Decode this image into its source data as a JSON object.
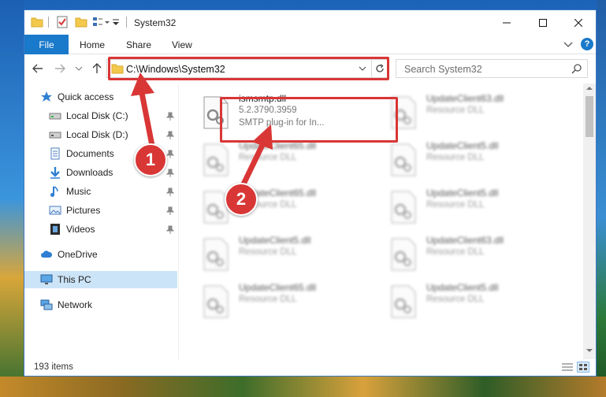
{
  "window": {
    "title": "System32",
    "ribbon_tabs": [
      "File",
      "Home",
      "Share",
      "View"
    ]
  },
  "navbar": {
    "address": "C:\\Windows\\System32",
    "search_placeholder": "Search System32"
  },
  "sidebar": {
    "items": [
      {
        "label": "Quick access",
        "icon": "star-icon",
        "pinned": false
      },
      {
        "label": "Local Disk (C:)",
        "icon": "drive-icon",
        "pinned": true
      },
      {
        "label": "Local Disk (D:)",
        "icon": "drive-icon",
        "pinned": true
      },
      {
        "label": "Documents",
        "icon": "documents-icon",
        "pinned": true
      },
      {
        "label": "Downloads",
        "icon": "download-arrow-icon",
        "pinned": true
      },
      {
        "label": "Music",
        "icon": "music-note-icon",
        "pinned": true
      },
      {
        "label": "Pictures",
        "icon": "pictures-icon",
        "pinned": true
      },
      {
        "label": "Videos",
        "icon": "film-icon",
        "pinned": true
      },
      {
        "label": "OneDrive",
        "icon": "cloud-icon",
        "pinned": false
      },
      {
        "label": "This PC",
        "icon": "monitor-icon",
        "pinned": false,
        "selected": true
      },
      {
        "label": "Network",
        "icon": "network-icon",
        "pinned": false
      }
    ]
  },
  "files": {
    "selected": {
      "name": "ismsmtp.dll",
      "version": "5.2.3790.3959",
      "description": "SMTP plug-in for In..."
    },
    "blurred": [
      {
        "name": "UpdateClient63.dll",
        "type": "Resource DLL"
      },
      {
        "name": "UpdateClient65.dll",
        "type": "Resource DLL"
      },
      {
        "name": "UpdateClient5.dll",
        "type": "Resource DLL"
      },
      {
        "name": "UpdateClient65.dll",
        "type": "Resource DLL"
      },
      {
        "name": "UpdateClient5.dll",
        "type": "Resource DLL"
      },
      {
        "name": "UpdateClient5.dll",
        "type": "Resource DLL"
      },
      {
        "name": "UpdateClient63.dll",
        "type": "Resource DLL"
      },
      {
        "name": "UpdateClient65.dll",
        "type": "Resource DLL"
      },
      {
        "name": "UpdateClient5.dll",
        "type": "Resource DLL"
      }
    ]
  },
  "status": {
    "item_count": "193 items"
  },
  "callouts": [
    "1",
    "2"
  ],
  "colors": {
    "accent": "#1979ca",
    "highlight": "#d93636",
    "selection": "#cce4f7"
  }
}
